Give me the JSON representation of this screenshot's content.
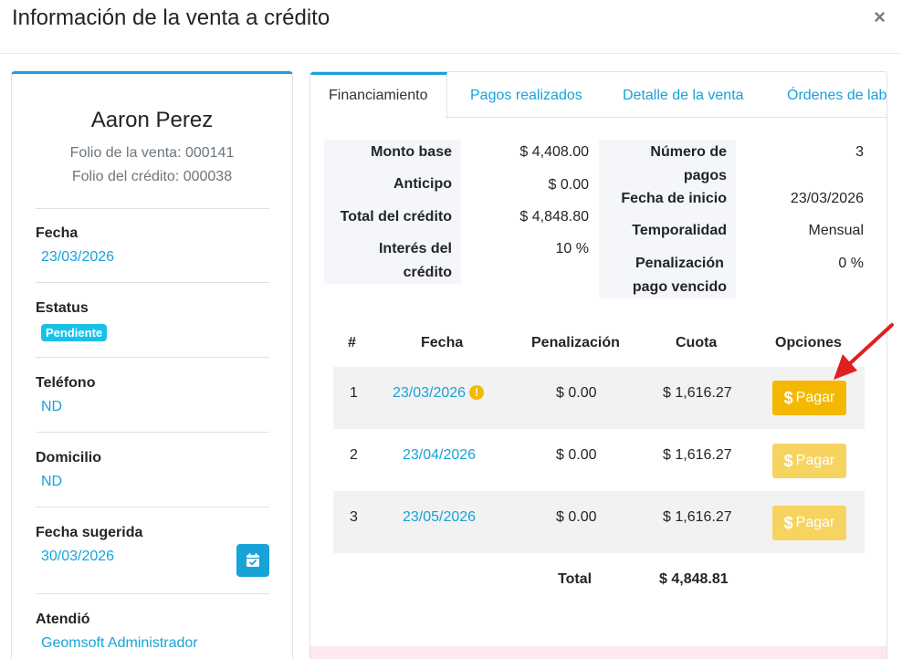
{
  "modal": {
    "title": "Información de la venta a crédito",
    "close": "×"
  },
  "client": {
    "name": "Aaron Perez",
    "folio_venta": "Folio de la venta: 000141",
    "folio_credito": "Folio del crédito: 000038"
  },
  "fields": {
    "fecha_label": "Fecha",
    "fecha_value": "23/03/2026",
    "estatus_label": "Estatus",
    "estatus_value": "Pendiente",
    "telefono_label": "Teléfono",
    "telefono_value": "ND",
    "domicilio_label": "Domicilio",
    "domicilio_value": "ND",
    "fecha_sugerida_label": "Fecha sugerida",
    "fecha_sugerida_value": "30/03/2026",
    "atendio_label": "Atendió",
    "atendio_value": "Geomsoft Administrador"
  },
  "tabs": [
    {
      "label": "Financiamiento"
    },
    {
      "label": "Pagos realizados"
    },
    {
      "label": "Detalle de la venta"
    },
    {
      "label": "Órdenes de lab"
    }
  ],
  "financing": {
    "monto_base_label": "Monto base",
    "monto_base": "$ 4,408.00",
    "anticipo_label": "Anticipo",
    "anticipo": "$ 0.00",
    "total_credito_label": "Total del crédito",
    "total_credito": "$ 4,848.80",
    "interes_label_1": "Interés del",
    "interes_label_2": "crédito",
    "interes": "10 %",
    "num_pagos_label_1": "Número de",
    "num_pagos_label_2": "pagos",
    "num_pagos": "3",
    "fecha_inicio_label": "Fecha de inicio",
    "fecha_inicio": "23/03/2026",
    "temporalidad_label": "Temporalidad",
    "temporalidad": "Mensual",
    "penalizacion_label_1": "Penalización",
    "penalizacion_label_2": "pago vencido",
    "penalizacion": "0 %"
  },
  "table": {
    "headers": {
      "num": "#",
      "fecha": "Fecha",
      "penalizacion": "Penalización",
      "cuota": "Cuota",
      "opciones": "Opciones"
    },
    "rows": [
      {
        "num": "1",
        "fecha": "23/03/2026",
        "penalizacion": "$ 0.00",
        "cuota": "$ 1,616.27",
        "btn_symbol": "$",
        "btn_label": "Pagar",
        "warning": "!"
      },
      {
        "num": "2",
        "fecha": "23/04/2026",
        "penalizacion": "$ 0.00",
        "cuota": "$ 1,616.27",
        "btn_symbol": "$",
        "btn_label": "Pagar"
      },
      {
        "num": "3",
        "fecha": "23/05/2026",
        "penalizacion": "$ 0.00",
        "cuota": "$ 1,616.27",
        "btn_symbol": "$",
        "btn_label": "Pagar"
      }
    ],
    "total_label": "Total",
    "total_value": "$ 4,848.81"
  },
  "colors": {
    "accent": "#17a2d8",
    "pay": "#f5b800",
    "pay_disabled": "#f7d460",
    "arrow": "#e02020"
  }
}
